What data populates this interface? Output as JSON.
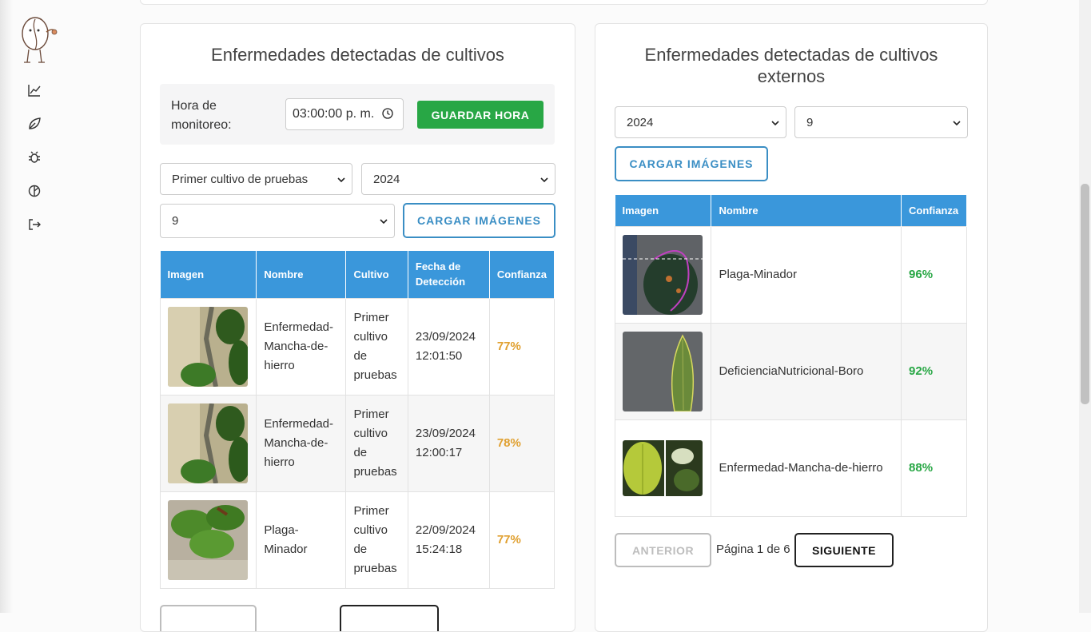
{
  "sidebar": {
    "items": [
      {
        "icon": "chart-line-icon",
        "name": "analytics"
      },
      {
        "icon": "leaf-icon",
        "name": "crops"
      },
      {
        "icon": "bug-icon",
        "name": "pests"
      },
      {
        "icon": "disease-icon",
        "name": "diseases"
      },
      {
        "icon": "logout-icon",
        "name": "logout"
      }
    ]
  },
  "left_panel": {
    "title": "Enfermedades detectadas de cultivos",
    "hour_label": "Hora de monitoreo:",
    "time_value": "03:00:00 p. m.",
    "save_hour_label": "GUARDAR HORA",
    "crop_select": "Primer cultivo de pruebas",
    "year_select": "2024",
    "month_select": "9",
    "load_images_label": "CARGAR IMÁGENES",
    "headers": [
      "Imagen",
      "Nombre",
      "Cultivo",
      "Fecha de Detección",
      "Confianza"
    ],
    "rows": [
      {
        "name": "Enfermedad-Mancha-de-hierro",
        "crop": "Primer cultivo de pruebas",
        "date": "23/09/2024 12:01:50",
        "confidence": "77%"
      },
      {
        "name": "Enfermedad-Mancha-de-hierro",
        "crop": "Primer cultivo de pruebas",
        "date": "23/09/2024 12:00:17",
        "confidence": "78%"
      },
      {
        "name": "Plaga-Minador",
        "crop": "Primer cultivo de pruebas",
        "date": "22/09/2024 15:24:18",
        "confidence": "77%"
      }
    ]
  },
  "right_panel": {
    "title": "Enfermedades detectadas de cultivos externos",
    "year_select": "2024",
    "month_select": "9",
    "load_images_label": "CARGAR IMÁGENES",
    "headers": [
      "Imagen",
      "Nombre",
      "Confianza"
    ],
    "rows": [
      {
        "name": "Plaga-Minador",
        "confidence": "96%"
      },
      {
        "name": "DeficienciaNutricional-Boro",
        "confidence": "92%"
      },
      {
        "name": "Enfermedad-Mancha-de-hierro",
        "confidence": "88%"
      }
    ],
    "prev_label": "ANTERIOR",
    "page_info": "Página 1 de 6",
    "next_label": "SIGUIENTE"
  },
  "colors": {
    "accent_blue": "#3a97db",
    "green": "#28a745",
    "mid_confidence": "#e0a030"
  }
}
